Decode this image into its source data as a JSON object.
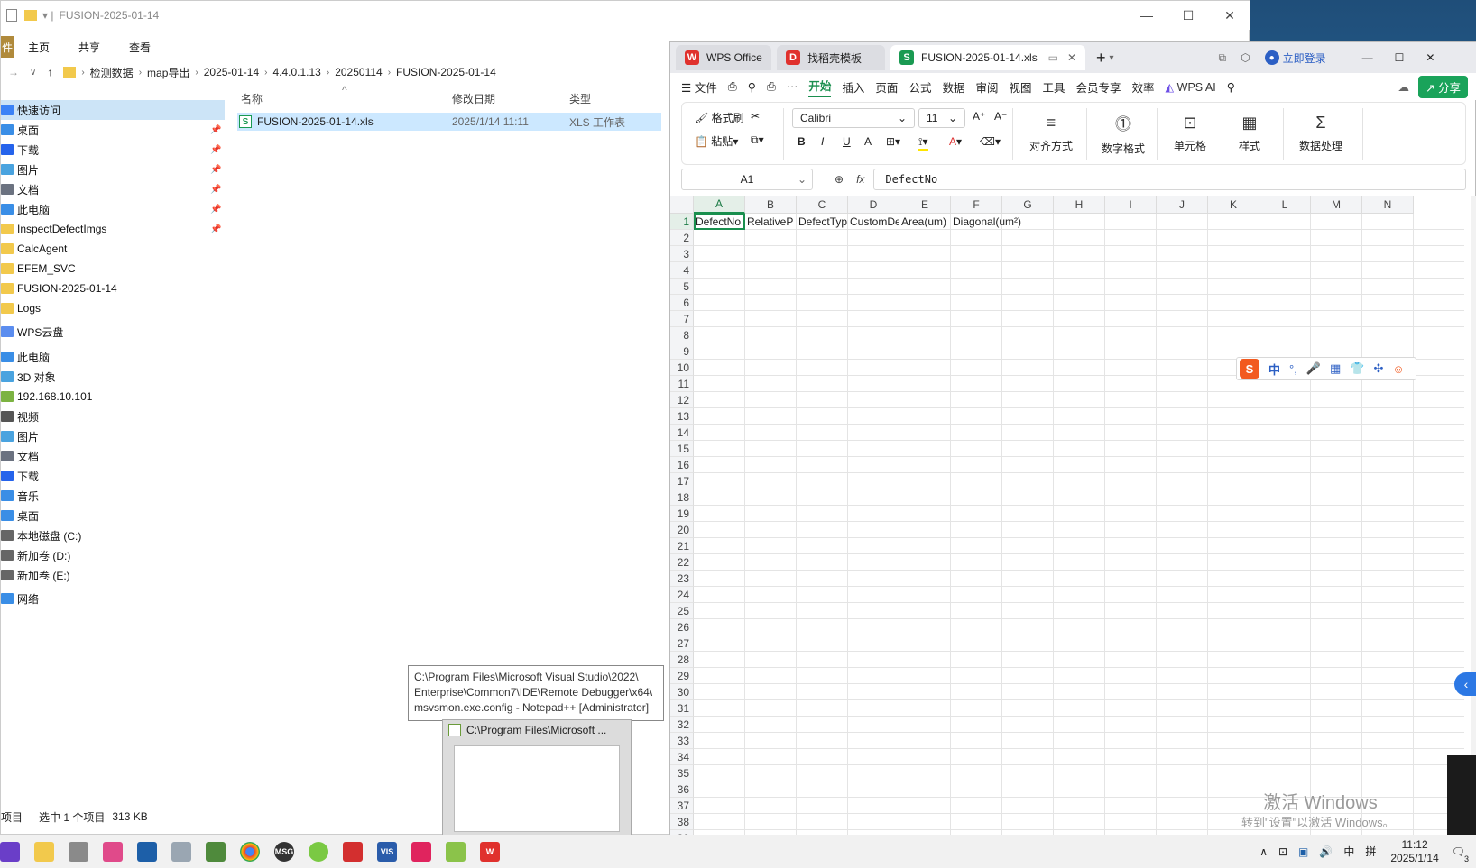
{
  "explorer": {
    "title": "FUSION-2025-01-14",
    "ribbon_tabs": [
      "件",
      "主页",
      "共享",
      "查看"
    ],
    "breadcrumb": [
      "检测数据",
      "map导出",
      "2025-01-14",
      "4.4.0.1.13",
      "20250114",
      "FUSION-2025-01-14"
    ],
    "columns": {
      "name": "名称",
      "modified": "修改日期",
      "type": "类型"
    },
    "file": {
      "name": "FUSION-2025-01-14.xls",
      "modified": "2025/1/14 11:11",
      "type": "XLS 工作表"
    },
    "nav": [
      {
        "label": "快速访问",
        "pin": false,
        "color": "#3b82f6"
      },
      {
        "label": "桌面",
        "pin": true,
        "color": "#3a8ee6"
      },
      {
        "label": "下载",
        "pin": true,
        "color": "#2563eb"
      },
      {
        "label": "图片",
        "pin": true,
        "color": "#4aa3df"
      },
      {
        "label": "文档",
        "pin": true,
        "color": "#6b7280"
      },
      {
        "label": "此电脑",
        "pin": true,
        "color": "#3a8ee6"
      },
      {
        "label": "InspectDefectImgs",
        "pin": true,
        "color": "#f2c94c"
      },
      {
        "label": "CalcAgent",
        "pin": false,
        "color": "#f2c94c"
      },
      {
        "label": "EFEM_SVC",
        "pin": false,
        "color": "#f2c94c"
      },
      {
        "label": "FUSION-2025-01-14",
        "pin": false,
        "color": "#f2c94c"
      },
      {
        "label": "Logs",
        "pin": false,
        "color": "#f2c94c"
      },
      {
        "label": "WPS云盘",
        "pin": false,
        "color": "#5b8def"
      },
      {
        "label": "此电脑",
        "pin": false,
        "color": "#3a8ee6"
      },
      {
        "label": "3D 对象",
        "pin": false,
        "color": "#4aa3df"
      },
      {
        "label": "192.168.10.101",
        "pin": false,
        "color": "#7cb342"
      },
      {
        "label": "视频",
        "pin": false,
        "color": "#555"
      },
      {
        "label": "图片",
        "pin": false,
        "color": "#4aa3df"
      },
      {
        "label": "文档",
        "pin": false,
        "color": "#6b7280"
      },
      {
        "label": "下载",
        "pin": false,
        "color": "#2563eb"
      },
      {
        "label": "音乐",
        "pin": false,
        "color": "#3a8ee6"
      },
      {
        "label": "桌面",
        "pin": false,
        "color": "#3a8ee6"
      },
      {
        "label": "本地磁盘 (C:)",
        "pin": false,
        "color": "#666"
      },
      {
        "label": "新加卷 (D:)",
        "pin": false,
        "color": "#666"
      },
      {
        "label": "新加卷 (E:)",
        "pin": false,
        "color": "#666"
      },
      {
        "label": "网络",
        "pin": false,
        "color": "#3a8ee6"
      }
    ],
    "status": {
      "count": "项目",
      "selected": "选中 1 个项目",
      "size": "313 KB"
    }
  },
  "wps": {
    "tabs": [
      {
        "label": "WPS Office",
        "logo": "W",
        "color": "#e0312d"
      },
      {
        "label": "找稻壳模板",
        "logo": "D",
        "color": "#e0312d"
      },
      {
        "label": "FUSION-2025-01-14.xls",
        "logo": "S",
        "color": "#1a9a52"
      }
    ],
    "login": "立即登录",
    "menu": [
      "文件",
      "开始",
      "插入",
      "页面",
      "公式",
      "数据",
      "审阅",
      "视图",
      "工具",
      "会员专享",
      "效率",
      "WPS AI"
    ],
    "share": "分享",
    "ribbon": {
      "format_painter": "格式刷",
      "paste": "粘贴",
      "font": "Calibri",
      "size": "11",
      "align": "对齐方式",
      "number": "数字格式",
      "cell": "单元格",
      "style": "样式",
      "data": "数据处理"
    },
    "namebox": "A1",
    "fx": "fx",
    "formula": "DefectNo",
    "columns": [
      "A",
      "B",
      "C",
      "D",
      "E",
      "F",
      "G",
      "H",
      "I",
      "J",
      "K",
      "L",
      "M",
      "N"
    ],
    "headers": [
      "DefectNo",
      "RelativeP",
      "DefectTyp",
      "CustomDe",
      "Area(um)",
      "Diagonal(um²)"
    ]
  },
  "tooltip": "C:\\Program Files\\Microsoft Visual Studio\\2022\\ Enterprise\\Common7\\IDE\\Remote Debugger\\x64\\ msvsmon.exe.config - Notepad++ [Administrator]",
  "thumb_title": "C:\\Program Files\\Microsoft ...",
  "ime": [
    "中",
    "°,",
    "🎤",
    "▦",
    "👕",
    "✣",
    "☺"
  ],
  "watermark": {
    "line1": "激活 Windows",
    "line2": "转到\"设置\"以激活 Windows。"
  },
  "tray": {
    "ime": "中",
    "layout": "拼",
    "time": "11:12",
    "date": "2025/1/14",
    "badge": "3"
  }
}
